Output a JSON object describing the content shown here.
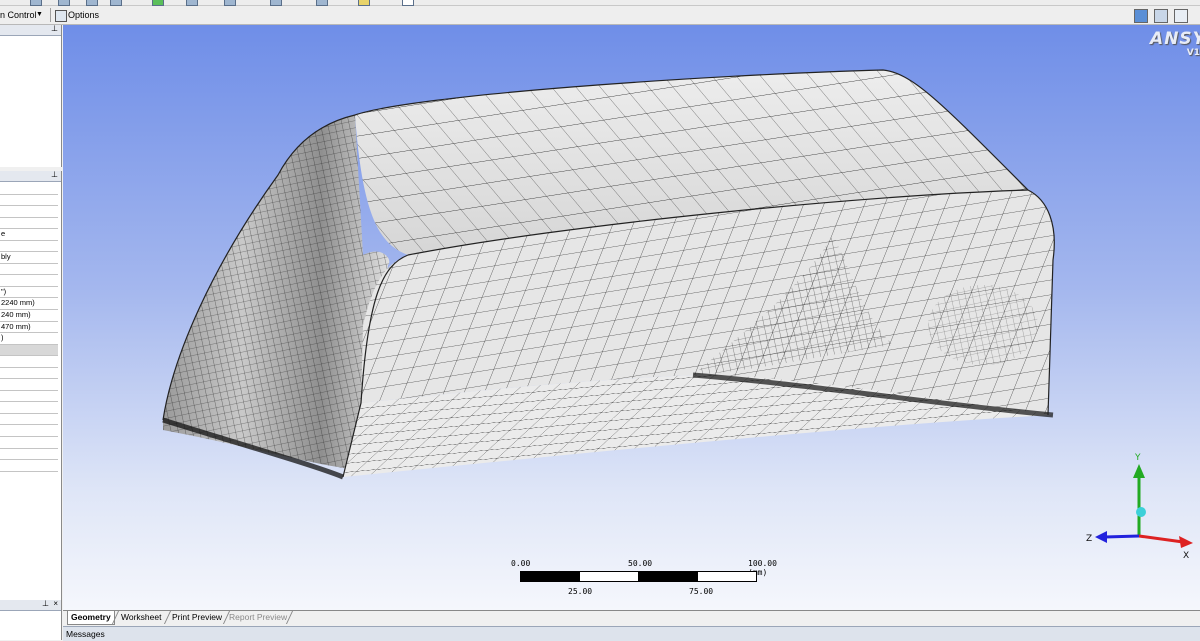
{
  "toolbar": {
    "mesh_control_label": "n Control",
    "options_label": "Options"
  },
  "left_panes": {
    "pin_symbol": "p",
    "details_rows": [
      "",
      "",
      "",
      "",
      "e",
      "",
      "bly",
      "",
      "",
      "\")",
      "2240 mm)",
      "240 mm)",
      "470 mm)",
      ")",
      "",
      "",
      "",
      "",
      "",
      "",
      "",
      "",
      "",
      "",
      ""
    ]
  },
  "viewport": {
    "logo": "ANSY",
    "logo_version": "V1",
    "triad": {
      "x": "X",
      "y": "Y",
      "z": "Z"
    },
    "scale": {
      "top_labels": [
        "0.00",
        "50.00",
        "100.00 (mm)"
      ],
      "bottom_labels": [
        "25.00",
        "75.00"
      ]
    }
  },
  "tabs": [
    {
      "label": "Geometry",
      "state": "active"
    },
    {
      "label": "Worksheet",
      "state": "normal"
    },
    {
      "label": "Print Preview",
      "state": "normal"
    },
    {
      "label": "Report Preview",
      "state": "disabled"
    }
  ],
  "messages_label": "Messages",
  "colors": {
    "viewport_top": "#6f8ee8",
    "viewport_bottom": "#f5f7fc",
    "axis_x": "#d22",
    "axis_y": "#2a2",
    "axis_z": "#22d"
  }
}
